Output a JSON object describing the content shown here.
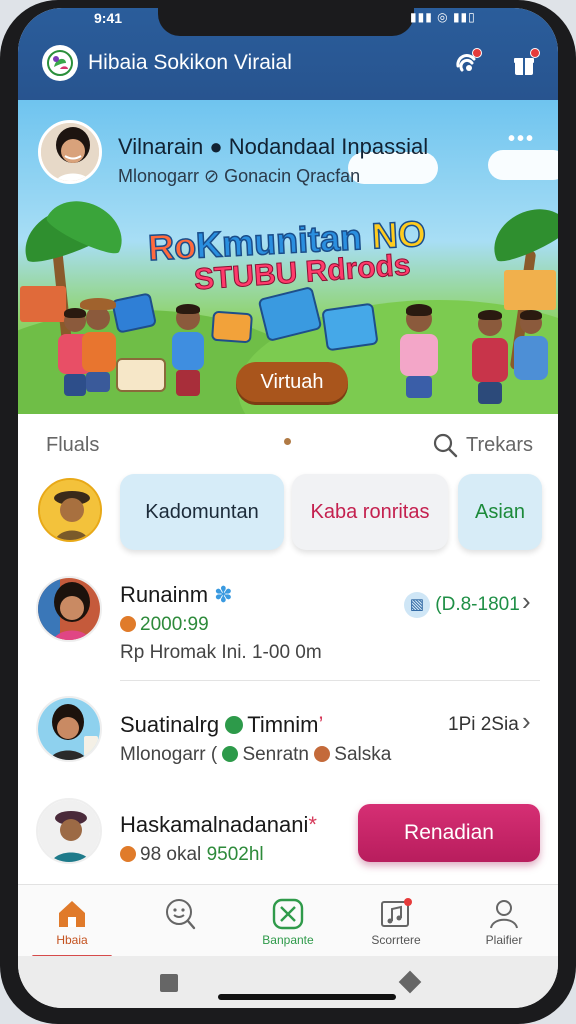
{
  "status": {
    "time": "9:41",
    "icons": "▮▮▮ ◎ ▮▮▯"
  },
  "appbar": {
    "title": "Hibaia Sokikon Viraial",
    "logo_icon": "leaf-logo",
    "icons": [
      "bell-sync-icon",
      "gift-icon"
    ],
    "color": "#2a5d9b"
  },
  "banner": {
    "name": "Vilnarain ● Nodandaal Inpassial",
    "subtitle": "Mlonogarr ⊘ Gonacin Qracfan",
    "more": "•••",
    "headline_1a": "Ro",
    "headline_1b": "Kmunitan ",
    "headline_1c": "NO",
    "headline_2": "STUBU Rdrods",
    "button": "Virtuah"
  },
  "section": {
    "left": "Fluals",
    "right": "Trekars"
  },
  "chips": [
    "Kadomuntan",
    "Kaba ronritas",
    "Asian"
  ],
  "list": [
    {
      "title": "Runainm",
      "line2": "2000:99",
      "line3": "Rp Hromak Ini. 1-00 0m",
      "right": "(D.8-1801",
      "accent": "#2d8a3a"
    },
    {
      "title": "Suatinalrg",
      "title_b": "Timnim",
      "line2": "Mlonogarr (",
      "line2_b": "Senratn",
      "line2_c": "Salska",
      "right": "1Pi 2Sia"
    },
    {
      "title": "Haskamalnadanani",
      "line2": "98 okal",
      "line2_b": "9502hl"
    }
  ],
  "cta": "Renadian",
  "nav": [
    {
      "label": "Hbaia",
      "icon": "home-icon"
    },
    {
      "label": "",
      "icon": "chat-search-icon"
    },
    {
      "label": "Banpante",
      "icon": "close-box-icon"
    },
    {
      "label": "Scorrtere",
      "icon": "music-note-icon"
    },
    {
      "label": "Plaifier",
      "icon": "person-icon"
    }
  ]
}
